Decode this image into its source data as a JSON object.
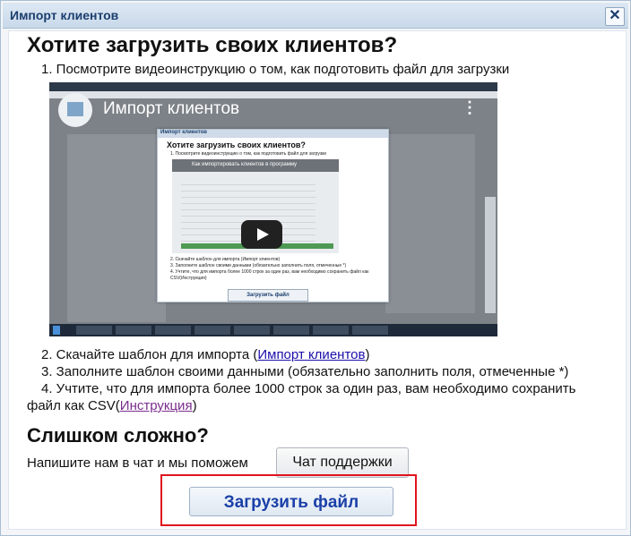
{
  "dialog": {
    "title": "Импорт клиентов",
    "close_label": "✕"
  },
  "main": {
    "heading": "Хотите загрузить своих клиентов?",
    "step1": "1. Посмотрите видеоинструкцию о том, как подготовить файл для загрузки",
    "step2_prefix": "2. Скачайте шаблон для импорта (",
    "step2_link": "Импорт клиентов",
    "step2_suffix": ")",
    "step3": "3. Заполните шаблон своими данными (обязательно заполнить поля, отмеченные *)",
    "step4_line1": "4. Учтите, что для импорта более 1000 строк за один раз, вам необходимо сохранить",
    "step4_line2_prefix": "файл как CSV(",
    "step4_link": "Инструкция",
    "step4_suffix": ")"
  },
  "video": {
    "title": "Импорт клиентов",
    "more_icon": "⋮",
    "inner": {
      "bar_title": "Импорт клиентов",
      "heading": "Хотите загрузить своих клиентов?",
      "step1": "1. Посмотрите видеоинструкцию о том, как подготовить файл для загрузки",
      "video_title": "Как импортировать клиентов в программу",
      "step2": "2. Скачайте шаблон для импорта (Импорт клиентов)",
      "step3": "3. Заполните шаблон своими данными (обязательно заполнить поля, отмеченные *)",
      "step4": "4. Учтите, что для импорта более 1000 строк за один раз, вам необходимо сохранить файл как CSV(Инструкция)",
      "upload_button": "Загрузить файл"
    }
  },
  "help": {
    "heading": "Слишком сложно?",
    "text": "Напишите нам в чат и мы поможем",
    "chat_button": "Чат поддержки"
  },
  "upload_button": "Загрузить файл",
  "colors": {
    "accent_red": "#e0141e",
    "button_text_blue": "#1a3fa8",
    "link": "#1a0dab"
  }
}
